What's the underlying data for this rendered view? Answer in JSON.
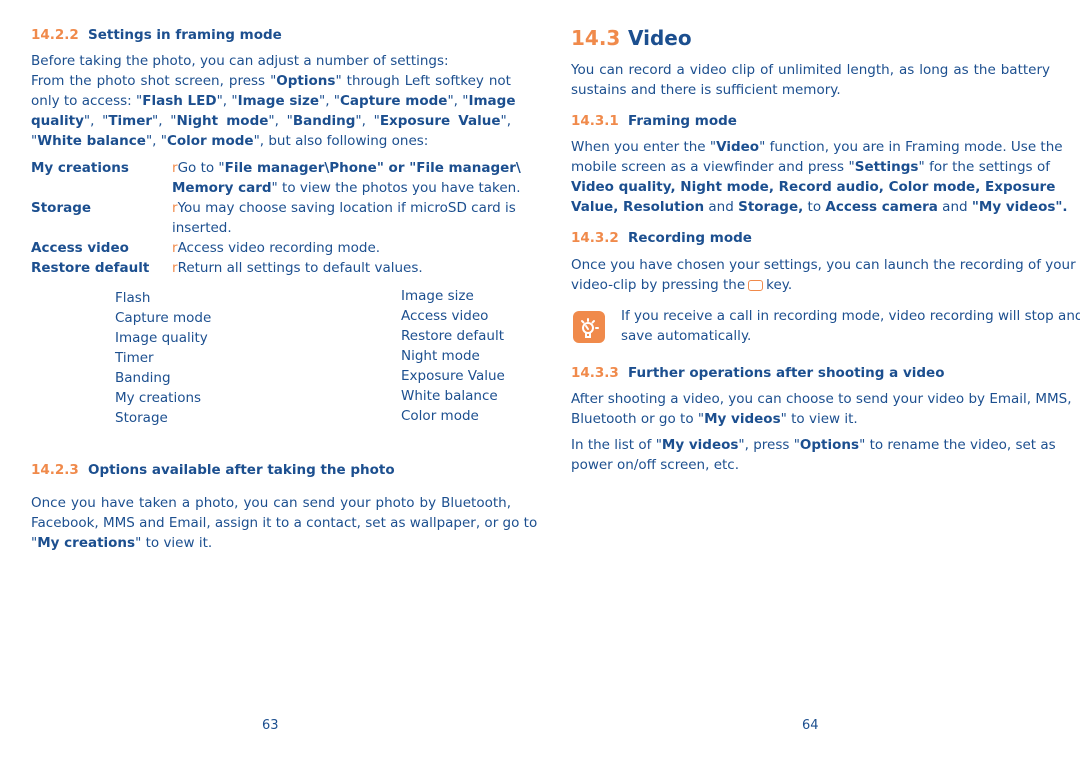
{
  "left_page": {
    "section_1422": {
      "number": "14.2.2",
      "title": "Settings in framing mode",
      "intro": "Before taking the photo, you can adjust a number of settings:",
      "para_lines": [
        [
          "From the photo shot screen, press \"",
          "Options",
          "\" through Left softkey not"
        ],
        [
          "only to access: \"",
          "Flash LED",
          "\", \"",
          "Image size",
          "\", \"",
          "Capture mode",
          "\", \"",
          "Image"
        ],
        [
          "quality",
          "\", \"",
          "Timer",
          "\", \"",
          "Night mode",
          "\", \"",
          "Banding",
          "\", \"",
          "Exposure Value",
          "\","
        ],
        [
          "\"",
          "White balance",
          "\", \"",
          "Color mode",
          "\", but also following ones:"
        ]
      ],
      "definitions": [
        {
          "term": "My creations",
          "bullet": "r",
          "def_line1_pre": "Go to \"",
          "def_line1_bold": "File manager\\Phone\" or \"File manager\\",
          "def_line2_bold": "Memory card",
          "def_line2_rest": "\" to view the photos you have taken."
        },
        {
          "term": "Storage",
          "bullet": "r",
          "def_line1": "You may choose saving location if microSD card is",
          "def_line2": "inserted."
        },
        {
          "term": "Access video",
          "bullet": "r",
          "def_line1": "Access video recording mode."
        },
        {
          "term": "Restore default",
          "bullet": "r",
          "def_line1": "Return all settings to default values."
        }
      ],
      "menu_col1": [
        "Flash",
        "Capture mode",
        "Image quality",
        "Timer",
        "Banding",
        "My creations",
        "Storage"
      ],
      "menu_col2": [
        "Image size",
        "Access video",
        "Restore default",
        "Night mode",
        "Exposure Value",
        "White balance",
        "Color mode"
      ]
    },
    "section_1423": {
      "number": "14.2.3",
      "title": "Options available after taking the photo",
      "lines": [
        "Once you have taken a photo, you can send your photo by Bluetooth,",
        "Facebook, MMS and Email, assign it to a contact, set as wallpaper, or go to"
      ],
      "last_pre": "\"",
      "last_bold": "My creations",
      "last_post": "\" to view it."
    },
    "page_number": "63"
  },
  "right_page": {
    "section_143": {
      "number": "14.3",
      "title": "Video",
      "lines": [
        "You can record a video clip of unlimited length, as long as the battery",
        "sustains and there is sufficient memory."
      ]
    },
    "section_1431": {
      "number": "14.3.1",
      "title": "Framing mode",
      "l1_pre": "When you enter the \"",
      "l1_bold": "Video",
      "l1_post": "\" function, you are in Framing mode. Use the",
      "l2_pre": "mobile screen as a viewfinder and press \"",
      "l2_bold": "Settings",
      "l2_post": "\" for the settings of",
      "l3_bold": "Video quality, Night mode, Record audio, Color mode, Exposure",
      "l4_b1": "Value, Resolution",
      "l4_t1": " and ",
      "l4_b2": "Storage,",
      "l4_t2": " to ",
      "l4_b3": "Access camera",
      "l4_t3": " and ",
      "l4_b4": "\"My videos\"."
    },
    "section_1432": {
      "number": "14.3.2",
      "title": "Recording mode",
      "line1": "Once you have chosen your settings, you can launch the recording of your",
      "line2_pre": "video-clip by pressing the",
      "line2_post": "key.",
      "tip_line1": "If you receive a call in recording mode, video recording will stop and",
      "tip_line2": "save automatically."
    },
    "section_1433": {
      "number": "14.3.3",
      "title": "Further operations after shooting a video",
      "p1_line1": "After shooting a video, you can choose to send your video by Email, MMS,",
      "p1_l2_pre": "Bluetooth or go to \"",
      "p1_l2_bold": "My videos",
      "p1_l2_post": "\" to view it.",
      "p2_l1_pre": "In the list of \"",
      "p2_l1_b1": "My videos",
      "p2_l1_mid": "\", press \"",
      "p2_l1_b2": "Options",
      "p2_l1_post": "\" to rename the video, set as",
      "p2_line2": "power on/off screen, etc."
    },
    "page_number": "64"
  },
  "colors": {
    "text": "#1c4f8f",
    "accent": "#f08a4b"
  }
}
